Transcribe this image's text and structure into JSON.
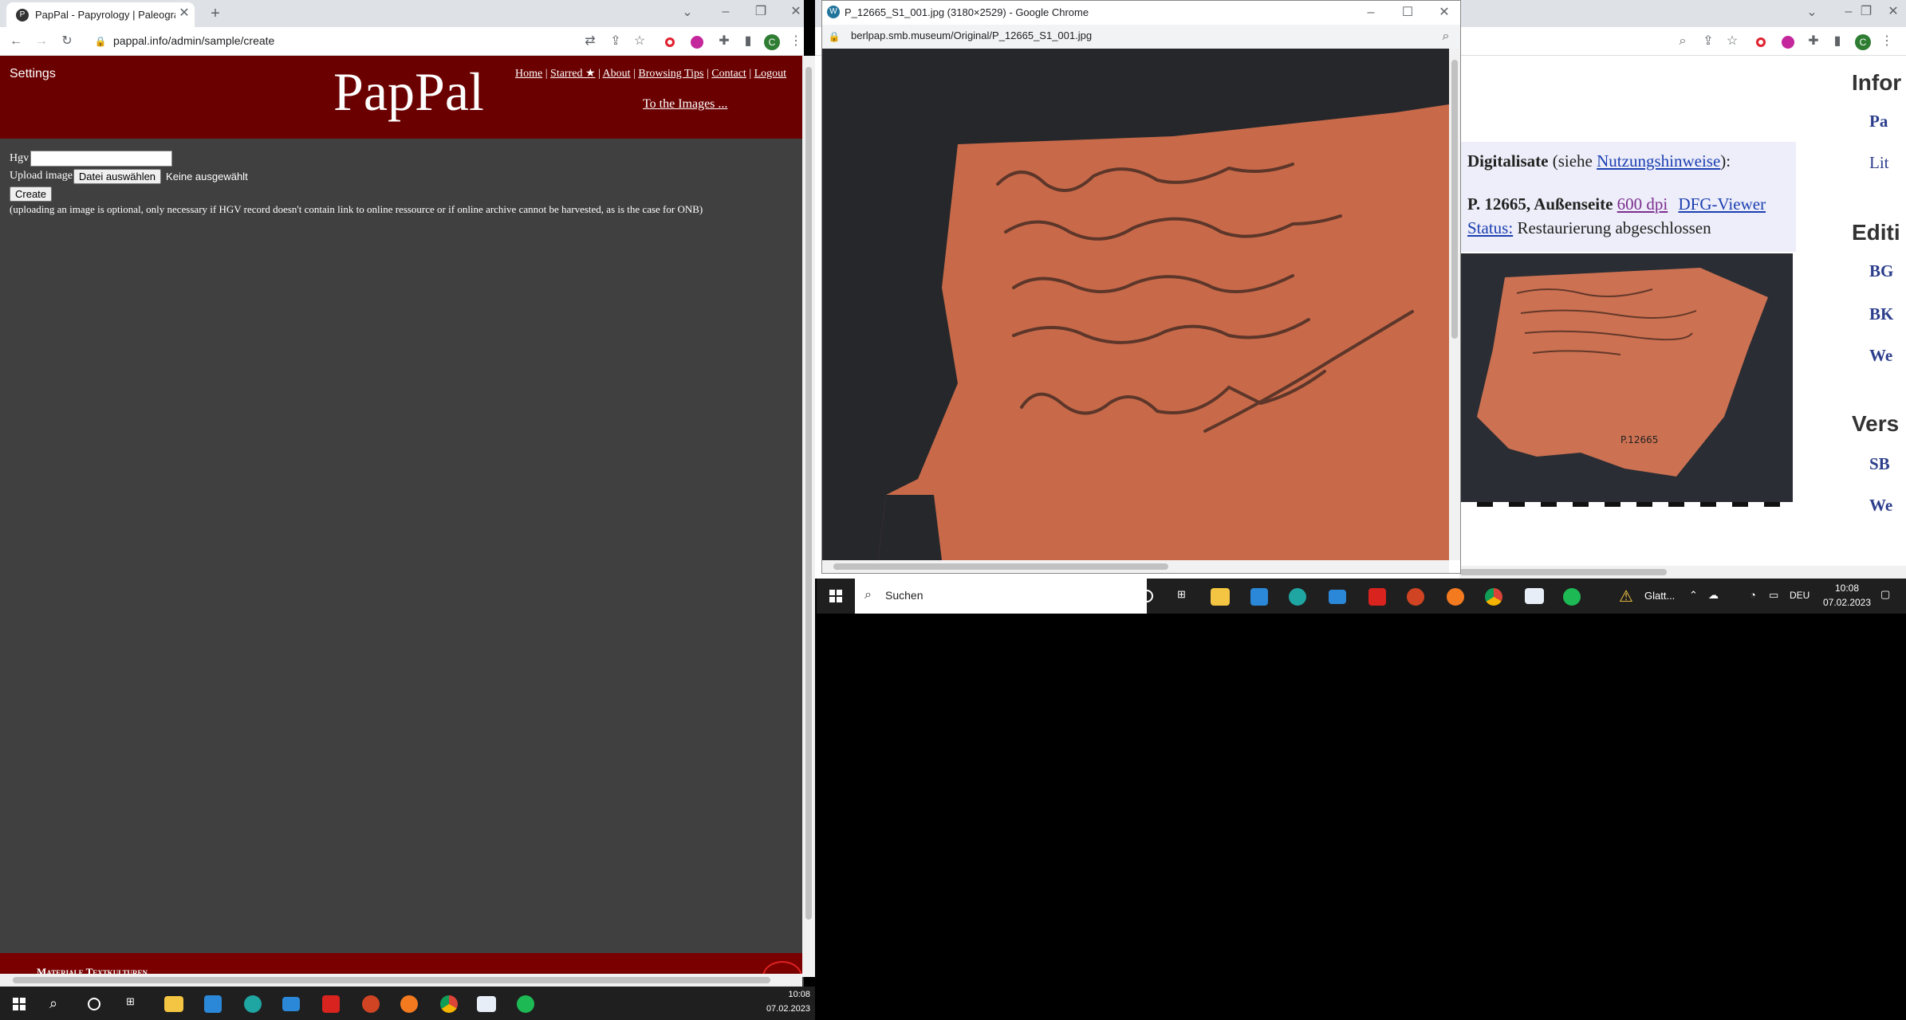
{
  "left_window": {
    "tab_title": "PapPal - Papyrology | Paleograph",
    "url": "pappal.info/admin/sample/create",
    "settings": "Settings",
    "logo": "PapPal",
    "nav": [
      "Home",
      "Starred ★",
      "About",
      "Browsing Tips",
      "Contact",
      "Logout"
    ],
    "to_images": "To the Images ...",
    "form": {
      "hgv_label": "Hgv",
      "upload_label": "Upload image",
      "file_button": "Datei auswählen",
      "file_status": "Keine ausgewählt",
      "create_button": "Create",
      "note": "(uploading an image is optional, only necessary if HGV record doesn't contain link to online ressource or if online archive cannot be harvested, as is the case for ONB)"
    },
    "footer": "Materiale Textkulturen",
    "profile_initial": "C"
  },
  "popup_window": {
    "title": "P_12665_S1_001.jpg (3180×2529) - Google Chrome",
    "url": "berlpap.smb.museum/Original/P_12665_S1_001.jpg"
  },
  "right_window": {
    "digitalisate_bold": "Digitalisate",
    "digitalisate_rest": " (siehe ",
    "nutzung": "Nutzungshinweise",
    "close_paren": "):",
    "p_label": "P. 12665, Außenseite",
    "dpi_link": "600 dpi",
    "dfg_link": "DFG-Viewer",
    "status_link": "Status:",
    "status_text": " Restaurierung abgeschlossen",
    "sidebar": {
      "h1": "Infor",
      "l1": "Pa",
      "l2": "Lit",
      "h2": "Editi",
      "l3": "BG",
      "l4": "BK",
      "l5": "We",
      "h3": "Vers",
      "l6": "SB",
      "l7": "We"
    },
    "thumb_label": "P.12665",
    "profile_initial": "C"
  },
  "taskbar_right": {
    "search": "Suchen",
    "weather": "Glatt...",
    "lang": "DEU",
    "time": "10:08",
    "date": "07.02.2023"
  },
  "taskbar_left": {
    "time": "10:08",
    "date": "07.02.2023"
  },
  "colors": {
    "header": "#6b0000",
    "body": "#404040",
    "footer": "#7a0000",
    "link": "#551a8b",
    "sidebar_link": "#2c3e8c"
  }
}
